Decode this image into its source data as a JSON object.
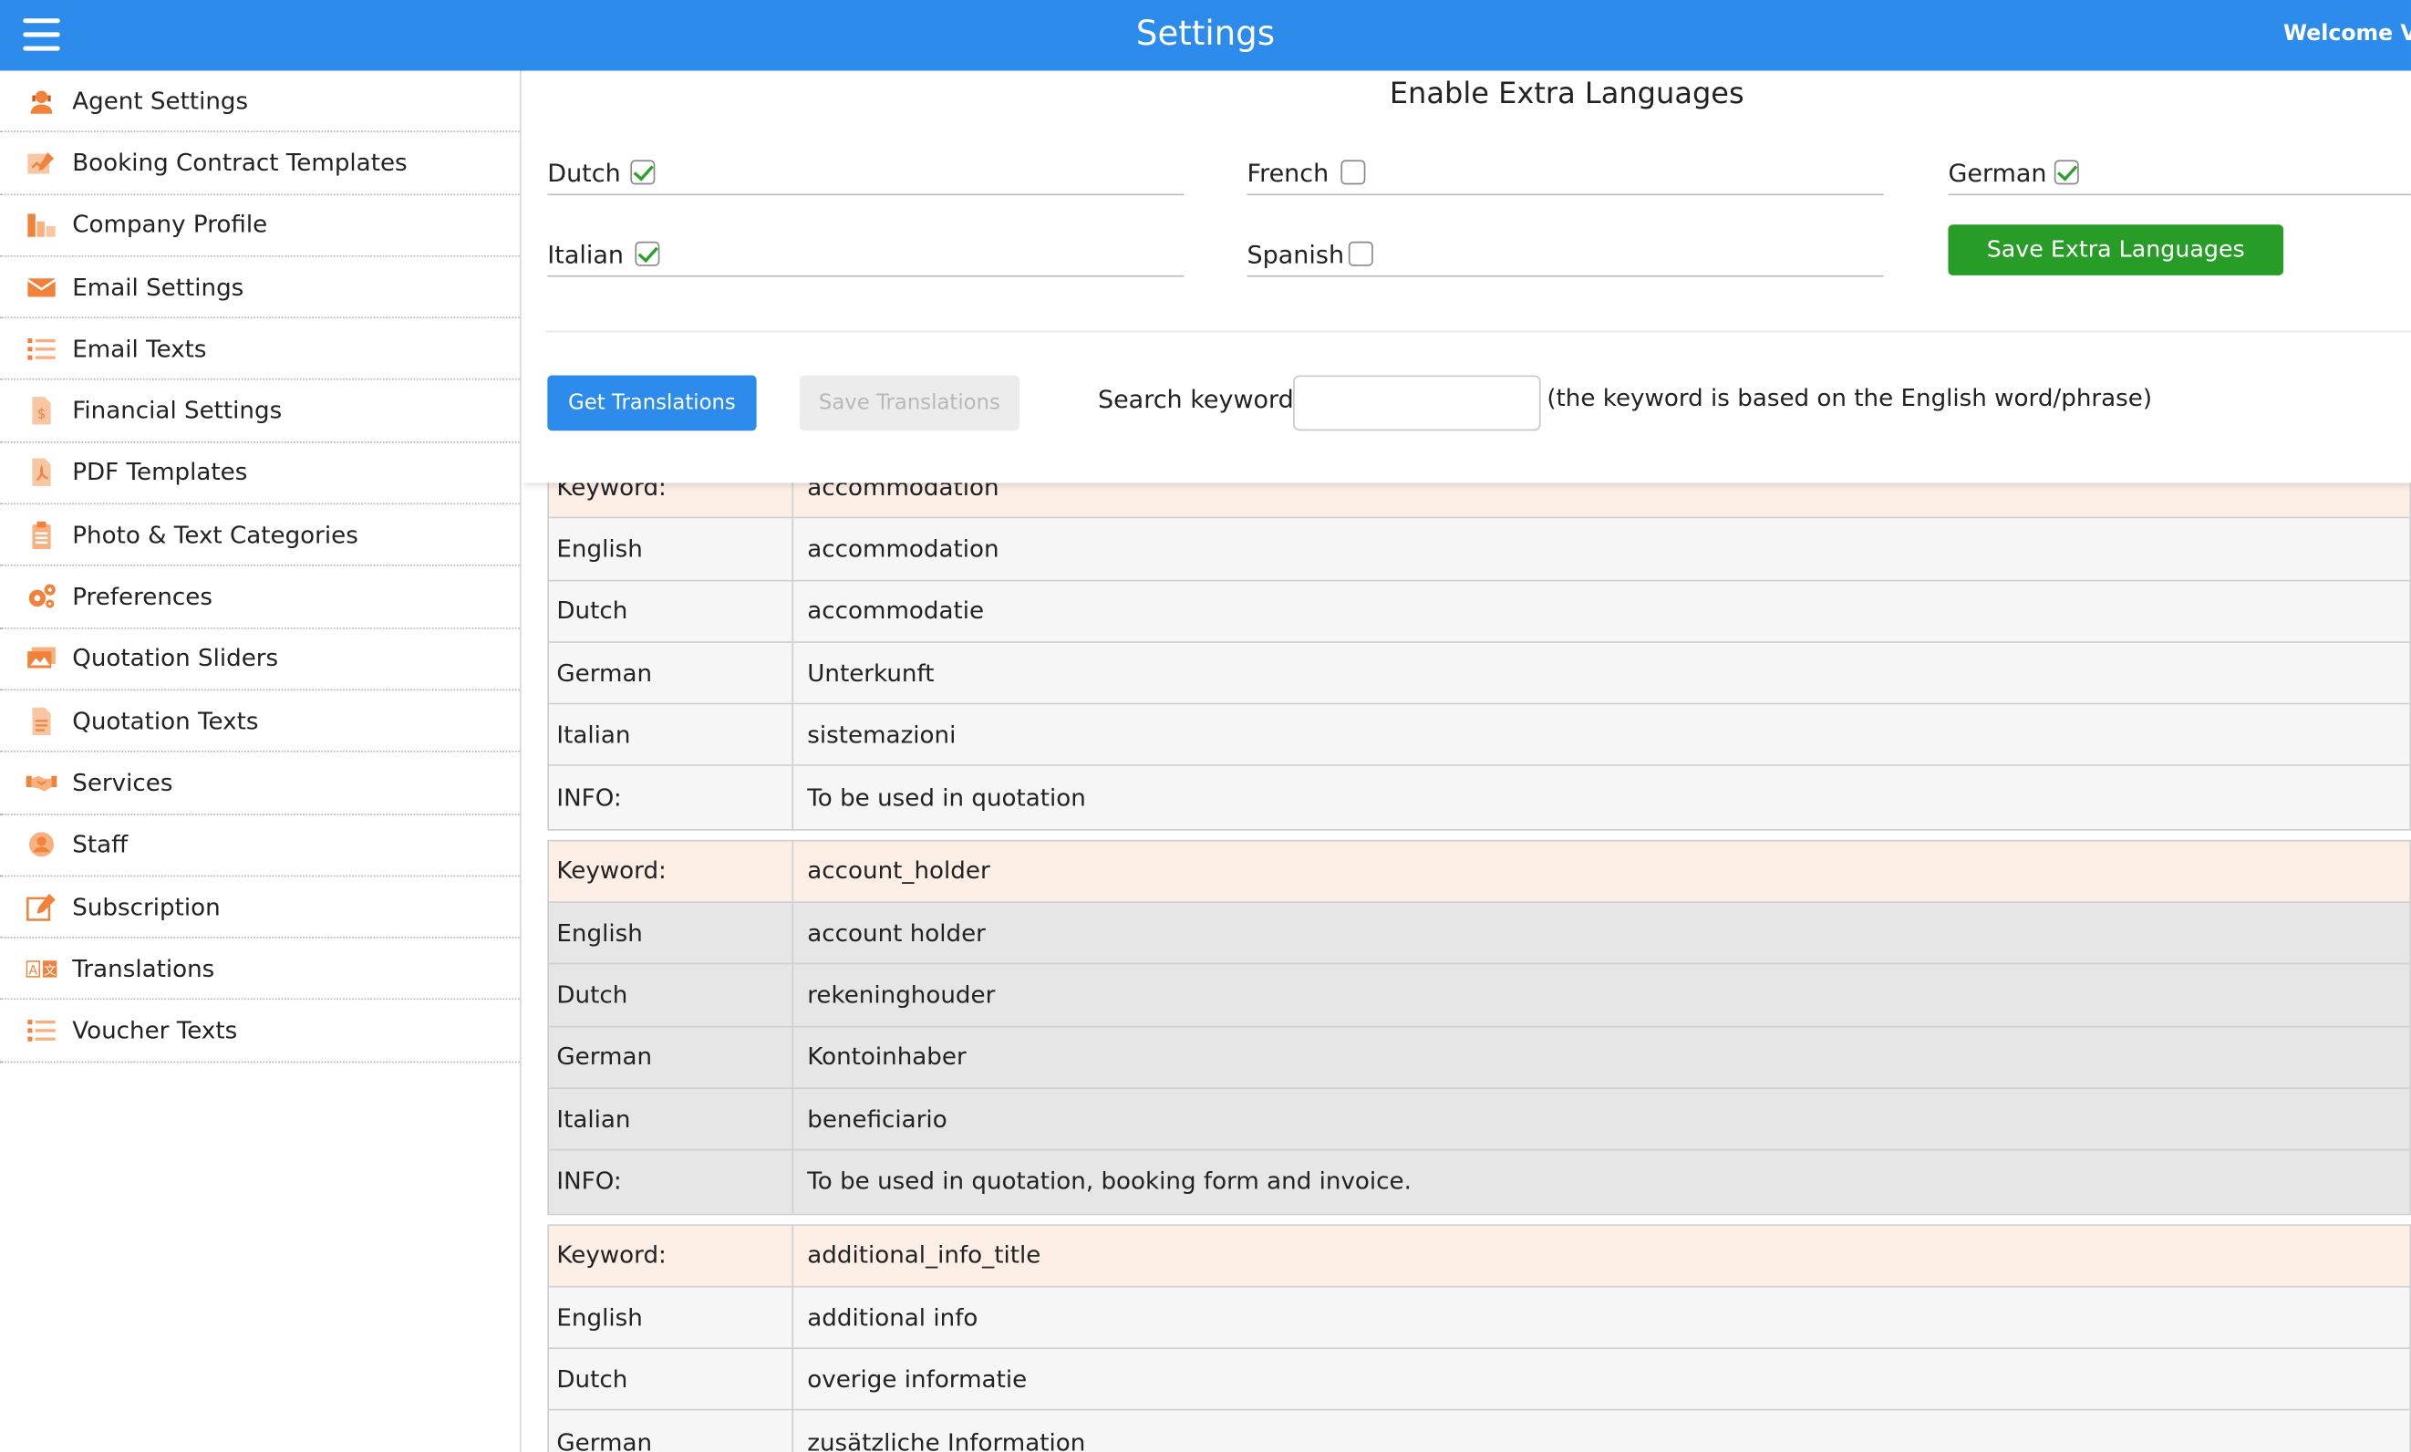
{
  "header": {
    "title": "Settings",
    "welcome": "Welcome Vi"
  },
  "sidebar": {
    "items": [
      {
        "label": "Agent Settings",
        "icon": "agent-icon"
      },
      {
        "label": "Booking Contract Templates",
        "icon": "contract-icon"
      },
      {
        "label": "Company Profile",
        "icon": "company-icon"
      },
      {
        "label": "Email Settings",
        "icon": "envelope-icon"
      },
      {
        "label": "Email Texts",
        "icon": "list-icon"
      },
      {
        "label": "Financial Settings",
        "icon": "financial-document-icon"
      },
      {
        "label": "PDF Templates",
        "icon": "pdf-icon"
      },
      {
        "label": "Photo & Text Categories",
        "icon": "clipboard-icon"
      },
      {
        "label": "Preferences",
        "icon": "gears-icon"
      },
      {
        "label": "Quotation Sliders",
        "icon": "images-icon"
      },
      {
        "label": "Quotation Texts",
        "icon": "document-icon"
      },
      {
        "label": "Services",
        "icon": "handshake-icon"
      },
      {
        "label": "Staff",
        "icon": "user-icon"
      },
      {
        "label": "Subscription",
        "icon": "edit-icon"
      },
      {
        "label": "Translations",
        "icon": "translate-icon"
      },
      {
        "label": "Voucher Texts",
        "icon": "list-icon"
      }
    ]
  },
  "languages": {
    "title": "Enable Extra Languages",
    "options": [
      {
        "name": "Dutch",
        "checked": true
      },
      {
        "name": "French",
        "checked": false
      },
      {
        "name": "German",
        "checked": true
      },
      {
        "name": "Italian",
        "checked": true
      },
      {
        "name": "Spanish",
        "checked": false
      }
    ],
    "save_label": "Save Extra Languages"
  },
  "toolbar": {
    "get_label": "Get Translations",
    "save_label": "Save Translations",
    "search_label": "Search keyword",
    "search_value": "",
    "search_hint": "(the keyword is based on the English word/phrase)"
  },
  "translations": [
    {
      "rows": [
        {
          "key": "Keyword:",
          "value": "accommodation"
        },
        {
          "key": "English",
          "value": "accommodation"
        },
        {
          "key": "Dutch",
          "value": "accommodatie"
        },
        {
          "key": "German",
          "value": "Unterkunft"
        },
        {
          "key": "Italian",
          "value": "sistemazioni"
        },
        {
          "key": "INFO:",
          "value": "To be used in quotation"
        }
      ]
    },
    {
      "rows": [
        {
          "key": "Keyword:",
          "value": "account_holder"
        },
        {
          "key": "English",
          "value": "account holder"
        },
        {
          "key": "Dutch",
          "value": "rekeninghouder"
        },
        {
          "key": "German",
          "value": "Kontoinhaber"
        },
        {
          "key": "Italian",
          "value": "beneficiario"
        },
        {
          "key": "INFO:",
          "value": "To be used in quotation, booking form and invoice."
        }
      ]
    },
    {
      "rows": [
        {
          "key": "Keyword:",
          "value": "additional_info_title"
        },
        {
          "key": "English",
          "value": "additional info"
        },
        {
          "key": "Dutch",
          "value": "overige informatie"
        },
        {
          "key": "German",
          "value": "zusätzliche Information"
        }
      ]
    }
  ],
  "colors": {
    "header_blue": "#2d8ceb",
    "save_green": "#279c27",
    "icon_orange": "#f0823c",
    "keyword_row": "#fdeee6"
  }
}
